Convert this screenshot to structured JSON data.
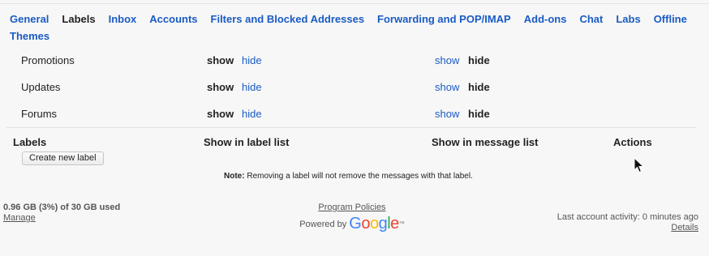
{
  "tabs": [
    {
      "label": "General",
      "active": false
    },
    {
      "label": "Labels",
      "active": true
    },
    {
      "label": "Inbox",
      "active": false
    },
    {
      "label": "Accounts",
      "active": false
    },
    {
      "label": "Filters and Blocked Addresses",
      "active": false
    },
    {
      "label": "Forwarding and POP/IMAP",
      "active": false
    },
    {
      "label": "Add-ons",
      "active": false
    },
    {
      "label": "Chat",
      "active": false
    },
    {
      "label": "Labs",
      "active": false
    },
    {
      "label": "Offline",
      "active": false
    },
    {
      "label": "Themes",
      "active": false
    }
  ],
  "category_rows": [
    {
      "name": "Promotions",
      "show_label": "show",
      "hide_label": "hide",
      "msg_show_label": "show",
      "msg_hide_label": "hide"
    },
    {
      "name": "Updates",
      "show_label": "show",
      "hide_label": "hide",
      "msg_show_label": "show",
      "msg_hide_label": "hide"
    },
    {
      "name": "Forums",
      "show_label": "show",
      "hide_label": "hide",
      "msg_show_label": "show",
      "msg_hide_label": "hide"
    }
  ],
  "labels_header": {
    "labels": "Labels",
    "show_in_label_list": "Show in label list",
    "show_in_message_list": "Show in message list",
    "actions": "Actions"
  },
  "create_label_button": "Create new label",
  "note": {
    "prefix": "Note:",
    "text": " Removing a label will not remove the messages with that label."
  },
  "footer": {
    "storage_used": "0.96 GB (3%) of 30 GB used",
    "manage": "Manage",
    "program_policies": "Program Policies",
    "powered_by": "Powered by",
    "google_logo": "Google",
    "last_activity": "Last account activity: 0 minutes ago",
    "details": "Details"
  },
  "icons": {
    "cursor": "mouse-pointer-icon"
  },
  "colors": {
    "link": "#1a5bc4",
    "background": "#f7f7f7"
  }
}
